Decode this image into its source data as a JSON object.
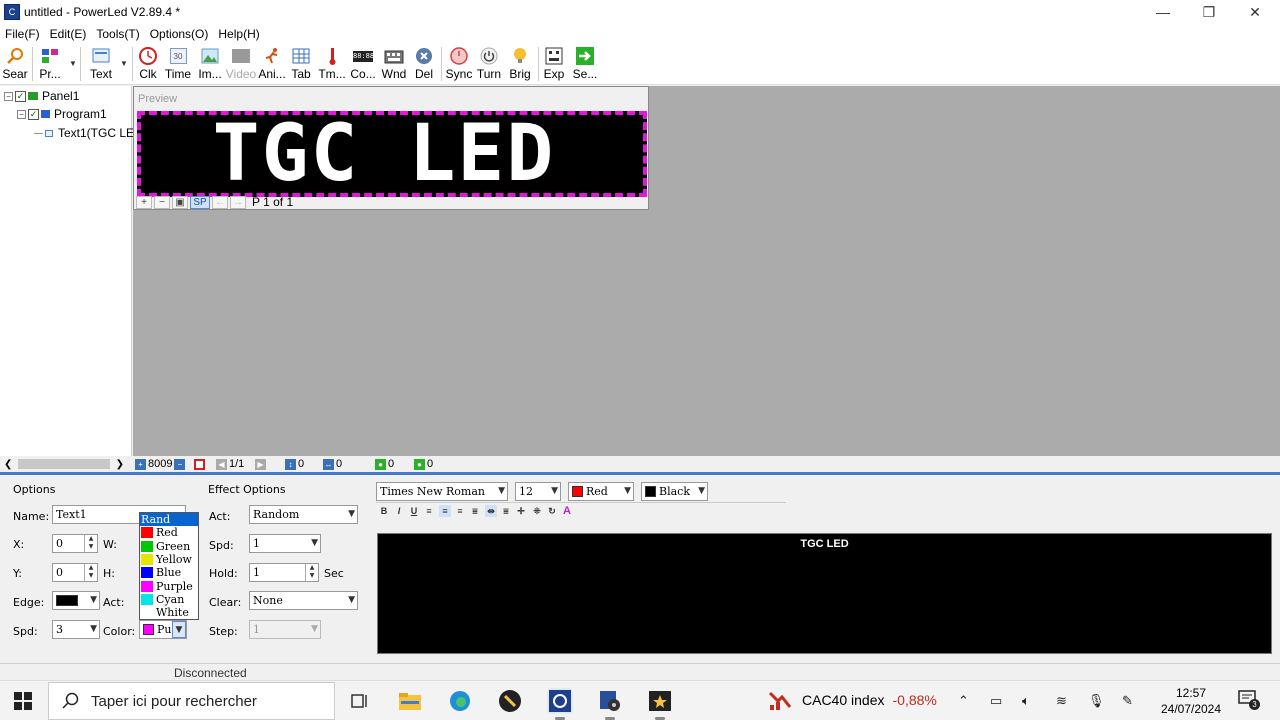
{
  "window": {
    "title": "untitled - PowerLed V2.89.4 *",
    "app_icon": "C"
  },
  "menu": [
    "File(F)",
    "Edit(E)",
    "Tools(T)",
    "Options(O)",
    "Help(H)"
  ],
  "toolbar": {
    "search": "Sear",
    "program": "Pr...",
    "text": "Text",
    "clock": "Clk",
    "time": "Time",
    "image": "Im...",
    "video": "Video",
    "animation": "Ani...",
    "table": "Tab",
    "temperature": "Tm...",
    "counter": "Co...",
    "window": "Wnd",
    "delete": "Del",
    "sync": "Sync",
    "turn": "Turn",
    "brightness": "Brig",
    "export": "Exp",
    "send": "Se...",
    "time_icon_text": "30",
    "counter_icon_text": "88:88"
  },
  "tree": {
    "panel": "Panel1",
    "program": "Program1",
    "text": "Text1(TGC LED"
  },
  "preview": {
    "title": "Preview",
    "led_text": "TGC LED",
    "page_info": "P 1 of 1",
    "sp_label": "SP",
    "plus": "+",
    "minus": "−"
  },
  "strip": {
    "count": "8009",
    "page": "1/1",
    "v1": "0",
    "v2": "0",
    "v3": "0",
    "v4": "0"
  },
  "options": {
    "title": "Options",
    "name_label": "Name:",
    "name_value": "Text1",
    "x_label": "X:",
    "x_value": "0",
    "w_label": "W:",
    "y_label": "Y:",
    "y_value": "0",
    "h_label": "H:",
    "edge_label": "Edge:",
    "act_label": "Act:",
    "spd_label": "Spd:",
    "spd_value": "3",
    "color_label": "Color:",
    "color_value": "Pu"
  },
  "color_list": [
    {
      "label": "Rand",
      "color": "",
      "selected": true
    },
    {
      "label": "Red",
      "color": "#ff0000"
    },
    {
      "label": "Green",
      "color": "#00c800"
    },
    {
      "label": "Yellow",
      "color": "#e6e600"
    },
    {
      "label": "Blue",
      "color": "#0000ff"
    },
    {
      "label": "Purple",
      "color": "#ff00ff"
    },
    {
      "label": "Cyan",
      "color": "#00e6e6"
    },
    {
      "label": "White",
      "color": "#ffffff"
    }
  ],
  "effect": {
    "title": "Effect Options",
    "act_label": "Act:",
    "act_value": "Random",
    "spd_label": "Spd:",
    "spd_value": "1",
    "hold_label": "Hold:",
    "hold_value": "1",
    "hold_unit": "Sec",
    "clear_label": "Clear:",
    "clear_value": "None",
    "step_label": "Step:",
    "step_value": "1"
  },
  "font": {
    "family": "Times New Roman",
    "size": "12",
    "fore": "Red",
    "back": "Black"
  },
  "format_buttons": [
    "B",
    "I",
    "U"
  ],
  "editor": {
    "text": "TGC LED"
  },
  "status": {
    "text": "Disconnected"
  },
  "taskbar": {
    "search_placeholder": "Taper ici pour rechercher",
    "stock_name": "CAC40 index",
    "stock_change": "-0,88%",
    "time": "12:57",
    "date": "24/07/2024",
    "notifications": "3"
  },
  "colors": {
    "led_border": "#e018d8",
    "accent": "#4a78c9",
    "selection": "#0a64d0"
  }
}
